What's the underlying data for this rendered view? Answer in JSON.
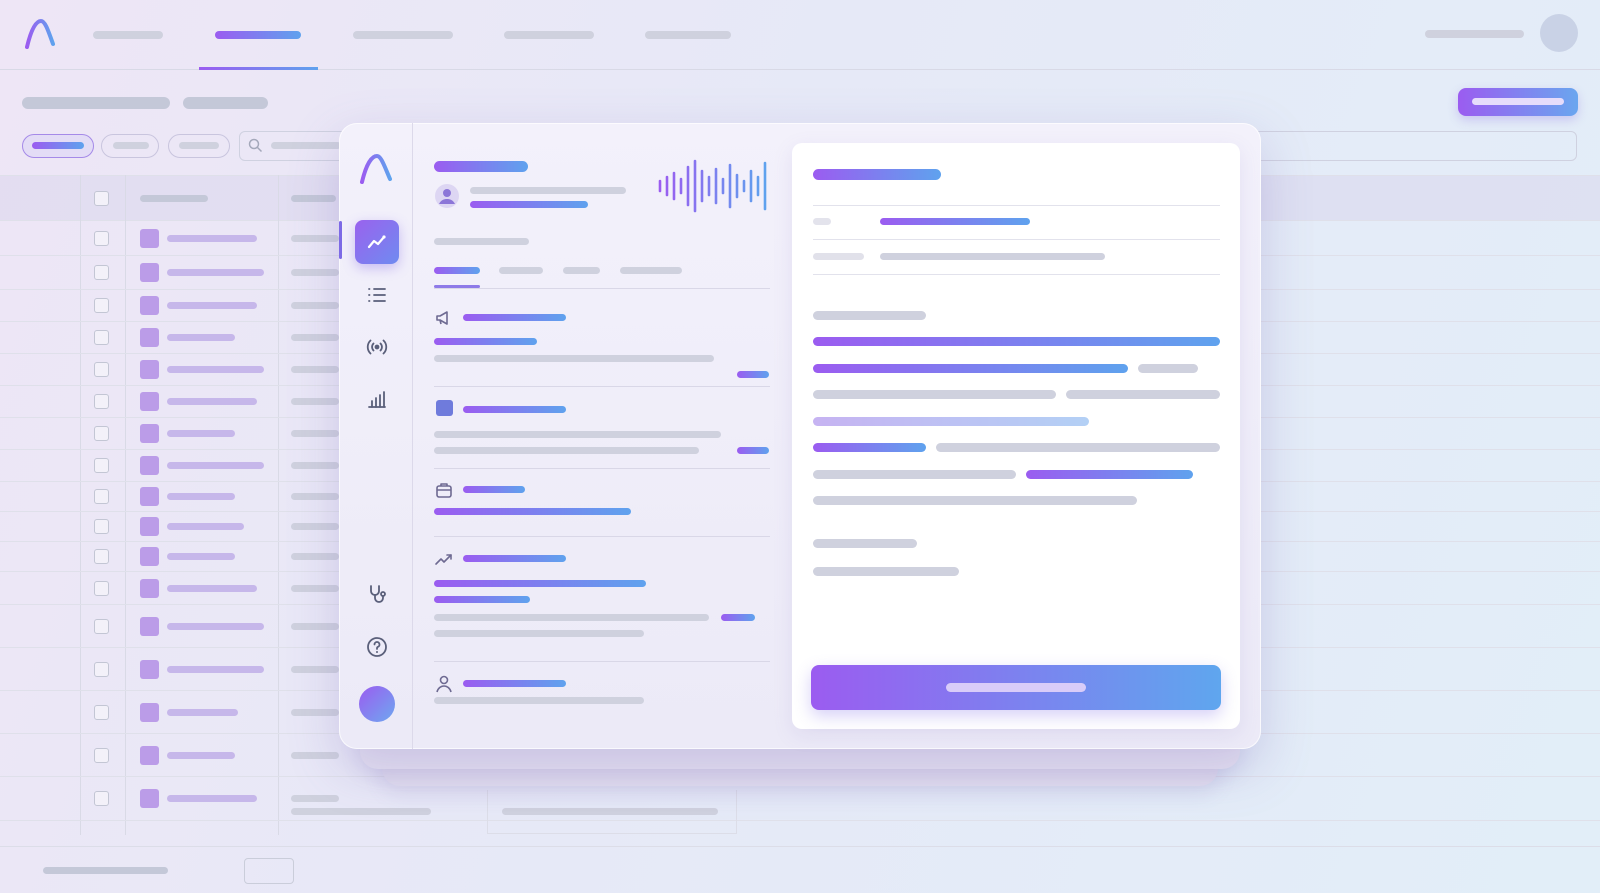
{
  "app": {
    "name": "",
    "logo_icon": "arc-logo-icon"
  },
  "colors": {
    "accent_start": "#9b5cf0",
    "accent_end": "#5fa2ee",
    "placeholder_gray": "#c4c8d8"
  },
  "nav": {
    "tabs": [
      {
        "label": ""
      },
      {
        "label": "",
        "active": true
      },
      {
        "label": ""
      },
      {
        "label": ""
      },
      {
        "label": ""
      }
    ],
    "user": ""
  },
  "page": {
    "title": "",
    "subtitle": "",
    "primary_button": ""
  },
  "filters": {
    "chips": [
      {
        "label": "",
        "active": true
      },
      {
        "label": ""
      },
      {
        "label": ""
      }
    ],
    "search_placeholder": ""
  },
  "table": {
    "rows": 17
  },
  "rail": {
    "items": [
      "trend-icon",
      "list-icon",
      "broadcast-icon",
      "bar-chart-icon",
      "stethoscope-icon",
      "help-icon"
    ]
  },
  "feed": {
    "header": {
      "title": "",
      "user": "",
      "status": ""
    },
    "tabs": [
      {
        "label": "",
        "active": true
      },
      {
        "label": ""
      },
      {
        "label": ""
      },
      {
        "label": ""
      }
    ],
    "items": [
      {
        "icon": "megaphone-icon",
        "title": ""
      },
      {
        "icon": "square-icon",
        "title": ""
      },
      {
        "icon": "briefcase-icon",
        "title": ""
      },
      {
        "icon": "trend-up-icon",
        "title": ""
      },
      {
        "icon": "person-icon",
        "title": ""
      }
    ]
  },
  "detail": {
    "title": "",
    "cta_label": ""
  },
  "footer": {
    "summary": "",
    "page": ""
  }
}
